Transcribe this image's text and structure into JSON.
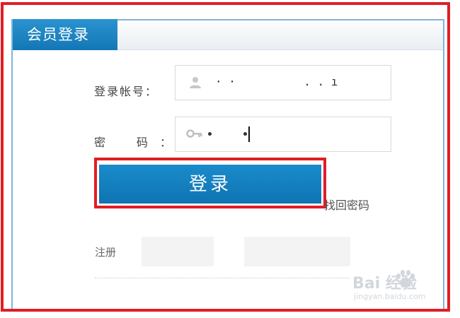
{
  "panel": {
    "tab_title": "会员登录"
  },
  "form": {
    "account_label": "登录帐号：",
    "password_label_char1": "密",
    "password_label_char2": "码",
    "password_colon": "：",
    "account_value": "· ·          . . ı",
    "account_icon": "user-icon",
    "password_icon": "key-icon",
    "login_button_label": "登录",
    "forgot_password_link": "找回密码",
    "register_label": "注册"
  },
  "watermark": {
    "brand": "Bai  经验",
    "url": "jingyan.baidu.com"
  },
  "colors": {
    "highlight": "#e01e25",
    "tab_blue": "#1a84c4",
    "button_blue": "#1380c0"
  }
}
